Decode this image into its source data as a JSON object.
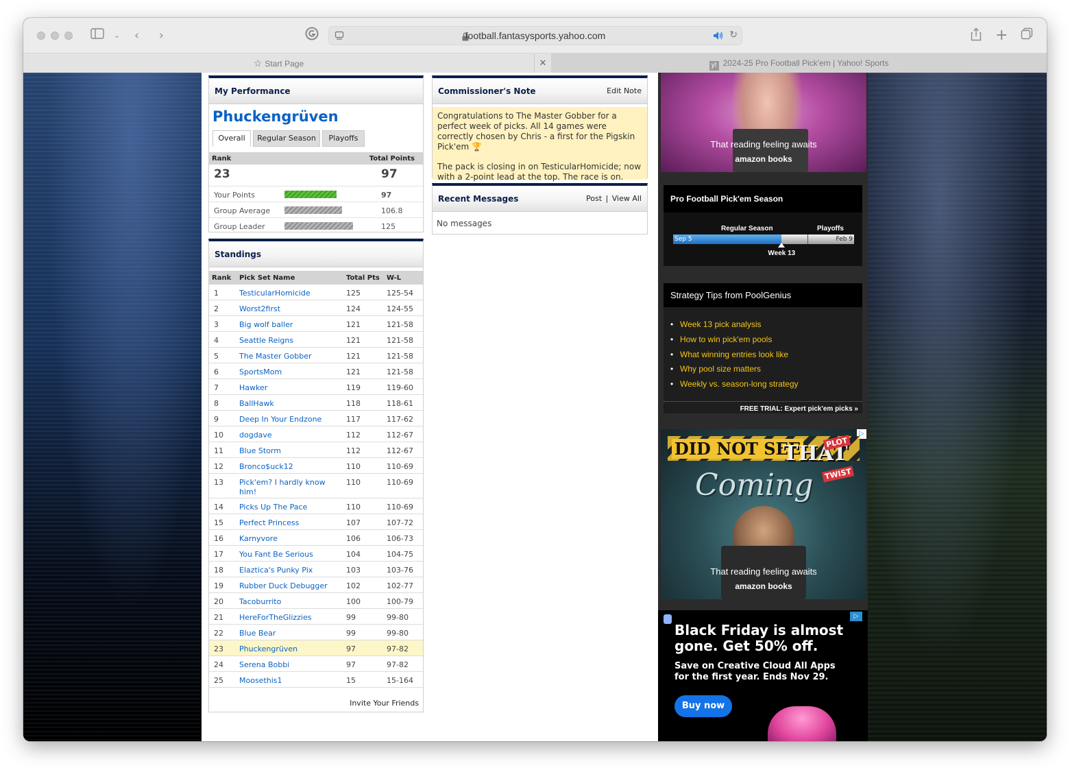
{
  "browser": {
    "url": "football.fantasysports.yahoo.com",
    "tabs": [
      {
        "label": "Start Page"
      },
      {
        "label": "2024-25 Pro Football Pick'em | Yahoo! Sports"
      }
    ]
  },
  "performance": {
    "title": "My Performance",
    "team_name": "Phuckengrüven",
    "tabs": [
      "Overall",
      "Regular Season",
      "Playoffs"
    ],
    "col_rank": "Rank",
    "col_total": "Total Points",
    "rank": "23",
    "total": "97",
    "rows": [
      {
        "label": "Your Points",
        "value": "97",
        "fill": 0.76
      },
      {
        "label": "Group Average",
        "value": "106.8",
        "fill": 0.84
      },
      {
        "label": "Group Leader",
        "value": "125",
        "fill": 1.0
      }
    ]
  },
  "standings": {
    "title": "Standings",
    "headers": [
      "Rank",
      "Pick Set Name",
      "Total Pts",
      "W-L"
    ],
    "rows": [
      {
        "rank": "1",
        "name": "TesticularHomicide",
        "pts": "125",
        "wl": "125-54"
      },
      {
        "rank": "2",
        "name": "Worst2first",
        "pts": "124",
        "wl": "124-55"
      },
      {
        "rank": "3",
        "name": "Big wolf baller",
        "pts": "121",
        "wl": "121-58"
      },
      {
        "rank": "4",
        "name": "Seattle Reigns",
        "pts": "121",
        "wl": "121-58"
      },
      {
        "rank": "5",
        "name": "The Master Gobber",
        "pts": "121",
        "wl": "121-58"
      },
      {
        "rank": "6",
        "name": "SportsMom",
        "pts": "121",
        "wl": "121-58"
      },
      {
        "rank": "7",
        "name": "Hawker",
        "pts": "119",
        "wl": "119-60"
      },
      {
        "rank": "8",
        "name": "BallHawk",
        "pts": "118",
        "wl": "118-61"
      },
      {
        "rank": "9",
        "name": "Deep In Your Endzone",
        "pts": "117",
        "wl": "117-62"
      },
      {
        "rank": "10",
        "name": "dogdave",
        "pts": "112",
        "wl": "112-67"
      },
      {
        "rank": "11",
        "name": "Blue Storm",
        "pts": "112",
        "wl": "112-67"
      },
      {
        "rank": "12",
        "name": "Bronco$uck12",
        "pts": "110",
        "wl": "110-69"
      },
      {
        "rank": "13",
        "name": "Pick'em? I hardly know him!",
        "pts": "110",
        "wl": "110-69"
      },
      {
        "rank": "14",
        "name": "Picks Up The Pace",
        "pts": "110",
        "wl": "110-69"
      },
      {
        "rank": "15",
        "name": "Perfect Princess",
        "pts": "107",
        "wl": "107-72"
      },
      {
        "rank": "16",
        "name": "Karnyvore",
        "pts": "106",
        "wl": "106-73"
      },
      {
        "rank": "17",
        "name": "You Fant Be Serious",
        "pts": "104",
        "wl": "104-75"
      },
      {
        "rank": "18",
        "name": "Elaztica's Punky Pix",
        "pts": "103",
        "wl": "103-76"
      },
      {
        "rank": "19",
        "name": "Rubber Duck Debugger",
        "pts": "102",
        "wl": "102-77"
      },
      {
        "rank": "20",
        "name": "Tacoburrito",
        "pts": "100",
        "wl": "100-79"
      },
      {
        "rank": "21",
        "name": "HereForTheGlizzies",
        "pts": "99",
        "wl": "99-80"
      },
      {
        "rank": "22",
        "name": "Blue Bear",
        "pts": "99",
        "wl": "99-80"
      },
      {
        "rank": "23",
        "name": "Phuckengrüven",
        "pts": "97",
        "wl": "97-82",
        "highlight": true
      },
      {
        "rank": "24",
        "name": "Serena Bobbi",
        "pts": "97",
        "wl": "97-82"
      },
      {
        "rank": "25",
        "name": "Moosethis1",
        "pts": "15",
        "wl": "15-164"
      }
    ],
    "invite": "Invite Your Friends"
  },
  "commissioner": {
    "title": "Commissioner's Note",
    "edit": "Edit Note",
    "p1": "Congratulations to The Master Gobber for a perfect week of picks. All 14 games were correctly chosen by Chris - a first for the Pigskin Pick'em 🏆",
    "p2": "The pack is closing in on TesticularHomicide; now with a 2-point lead at the top. The race is on."
  },
  "messages": {
    "title": "Recent Messages",
    "post": "Post",
    "sep": "|",
    "view_all": "View All",
    "empty": "No messages"
  },
  "ad_top": {
    "caption": "That reading feeling awaits",
    "brand": "amazon books"
  },
  "season": {
    "title": "Pro Football Pick'em Season",
    "regular": "Regular Season",
    "playoffs": "Playoffs",
    "start": "Sep 5",
    "end": "Feb 9",
    "current": "Week 13",
    "progress": 0.6
  },
  "tips": {
    "title": "Strategy Tips from PoolGenius",
    "items": [
      "Week 13 pick analysis",
      "How to win pick'em pools",
      "What winning entries look like",
      "Why pool size matters",
      "Weekly vs. season-long strategy"
    ],
    "footer": "FREE TRIAL: Expert pick'em picks »"
  },
  "ad_middle": {
    "headline1": "DID NOT SEE",
    "headline2": "THAT",
    "tag1": "PLOT",
    "tag2": "TWIST",
    "coming": "Coming",
    "caption": "That reading feeling awaits",
    "brand": "amazon books"
  },
  "ad_bottom": {
    "headline": "Black Friday is almost gone. Get 50% off.",
    "sub": "Save on Creative Cloud All Apps for the first year. Ends Nov 29.",
    "button": "Buy now"
  },
  "colors": {
    "accent_blue": "#0a62c4",
    "module_top": "#0c1f4a",
    "highlight_row": "#fdf6c8",
    "note_bg": "#fff2c0",
    "tip_link": "#f5c518",
    "progress_blue": "#1f7fd1"
  }
}
